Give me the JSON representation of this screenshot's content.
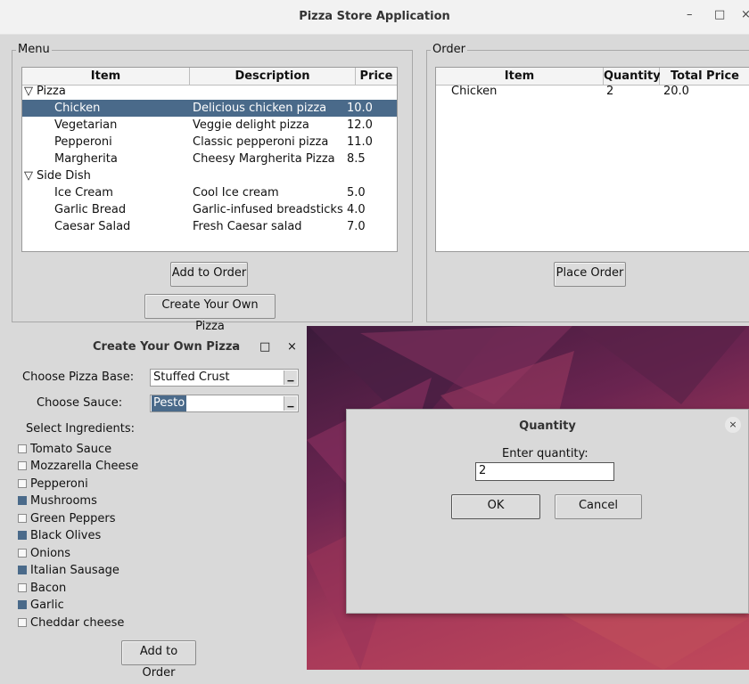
{
  "main_window": {
    "title": "Pizza Store Application",
    "controls": [
      "–",
      "□",
      "×"
    ]
  },
  "menu": {
    "group_label": "Menu",
    "columns": [
      "Item",
      "Description",
      "Price"
    ],
    "categories": [
      {
        "name": "Pizza",
        "items": [
          {
            "item": "Chicken",
            "description": "Delicious chicken pizza",
            "price": "10.0",
            "selected": true
          },
          {
            "item": "Vegetarian",
            "description": "Veggie delight pizza",
            "price": "12.0"
          },
          {
            "item": "Pepperoni",
            "description": "Classic pepperoni pizza",
            "price": "11.0"
          },
          {
            "item": "Margherita",
            "description": "Cheesy Margherita Pizza",
            "price": "8.5"
          }
        ]
      },
      {
        "name": "Side Dish",
        "items": [
          {
            "item": "Ice Cream",
            "description": "Cool Ice cream",
            "price": "5.0"
          },
          {
            "item": "Garlic Bread",
            "description": "Garlic-infused breadsticks",
            "price": "4.0"
          },
          {
            "item": "Caesar Salad",
            "description": "Fresh Caesar salad",
            "price": "7.0"
          }
        ]
      }
    ],
    "add_button": "Add to Order",
    "create_button": "Create Your Own Pizza"
  },
  "order": {
    "group_label": "Order",
    "columns": [
      "Item",
      "Quantity",
      "Total Price"
    ],
    "rows": [
      {
        "item": "Chicken",
        "quantity": "2",
        "total": "20.0"
      }
    ],
    "place_button": "Place Order"
  },
  "create_window": {
    "title": "Create Your Own Pizza",
    "controls": [
      "–",
      "□",
      "×"
    ],
    "base_label": "Choose Pizza Base:",
    "base_value": "Stuffed Crust",
    "sauce_label": "Choose Sauce:",
    "sauce_value": "Pesto",
    "ingredients_label": "Select Ingredients:",
    "ingredients": [
      {
        "name": "Tomato Sauce",
        "checked": false
      },
      {
        "name": "Mozzarella Cheese",
        "checked": false
      },
      {
        "name": "Pepperoni",
        "checked": false
      },
      {
        "name": "Mushrooms",
        "checked": true
      },
      {
        "name": "Green Peppers",
        "checked": false
      },
      {
        "name": "Black Olives",
        "checked": true
      },
      {
        "name": "Onions",
        "checked": false
      },
      {
        "name": "Italian Sausage",
        "checked": true
      },
      {
        "name": "Bacon",
        "checked": false
      },
      {
        "name": "Garlic",
        "checked": true
      },
      {
        "name": "Cheddar cheese",
        "checked": false
      }
    ],
    "add_button": "Add to Order"
  },
  "quantity_dialog": {
    "title": "Quantity",
    "close": "×",
    "prompt": "Enter quantity:",
    "value": "2",
    "ok": "OK",
    "cancel": "Cancel"
  },
  "icons": {
    "expand": "▽",
    "combo_arrow": "▁"
  },
  "colors": {
    "selection": "#4a6a8a",
    "window_bg": "#d9d9d9"
  }
}
